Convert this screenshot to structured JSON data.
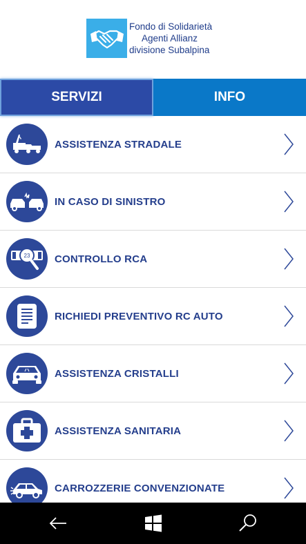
{
  "header": {
    "logo": {
      "line1": "Fondo di Solidarietà",
      "line2": "Agenti Allianz",
      "line3": "divisione Subalpina",
      "icon": "handshake-icon",
      "color": "#3aaee8"
    }
  },
  "tabs": [
    {
      "label": "SERVIZI",
      "selected": true,
      "color": "#2c4aa6"
    },
    {
      "label": "INFO",
      "selected": false,
      "color": "#0a78c8"
    }
  ],
  "items": [
    {
      "label": "ASSISTENZA STRADALE",
      "icon": "tow-truck-icon"
    },
    {
      "label": "IN CASO DI SINISTRO",
      "icon": "car-crash-icon"
    },
    {
      "label": "CONTROLLO RCA",
      "icon": "license-plate-search-icon"
    },
    {
      "label": "RICHIEDI PREVENTIVO RC AUTO",
      "icon": "document-icon"
    },
    {
      "label": "ASSISTENZA CRISTALLI",
      "icon": "car-windshield-icon"
    },
    {
      "label": "ASSISTENZA SANITARIA",
      "icon": "medical-kit-icon"
    },
    {
      "label": "CARROZZERIE CONVENZIONATE",
      "icon": "car-icon"
    }
  ],
  "colors": {
    "accent": "#2d4899",
    "text": "#243e8c"
  },
  "navbar": {
    "buttons": [
      "back-icon",
      "windows-icon",
      "search-icon"
    ]
  }
}
